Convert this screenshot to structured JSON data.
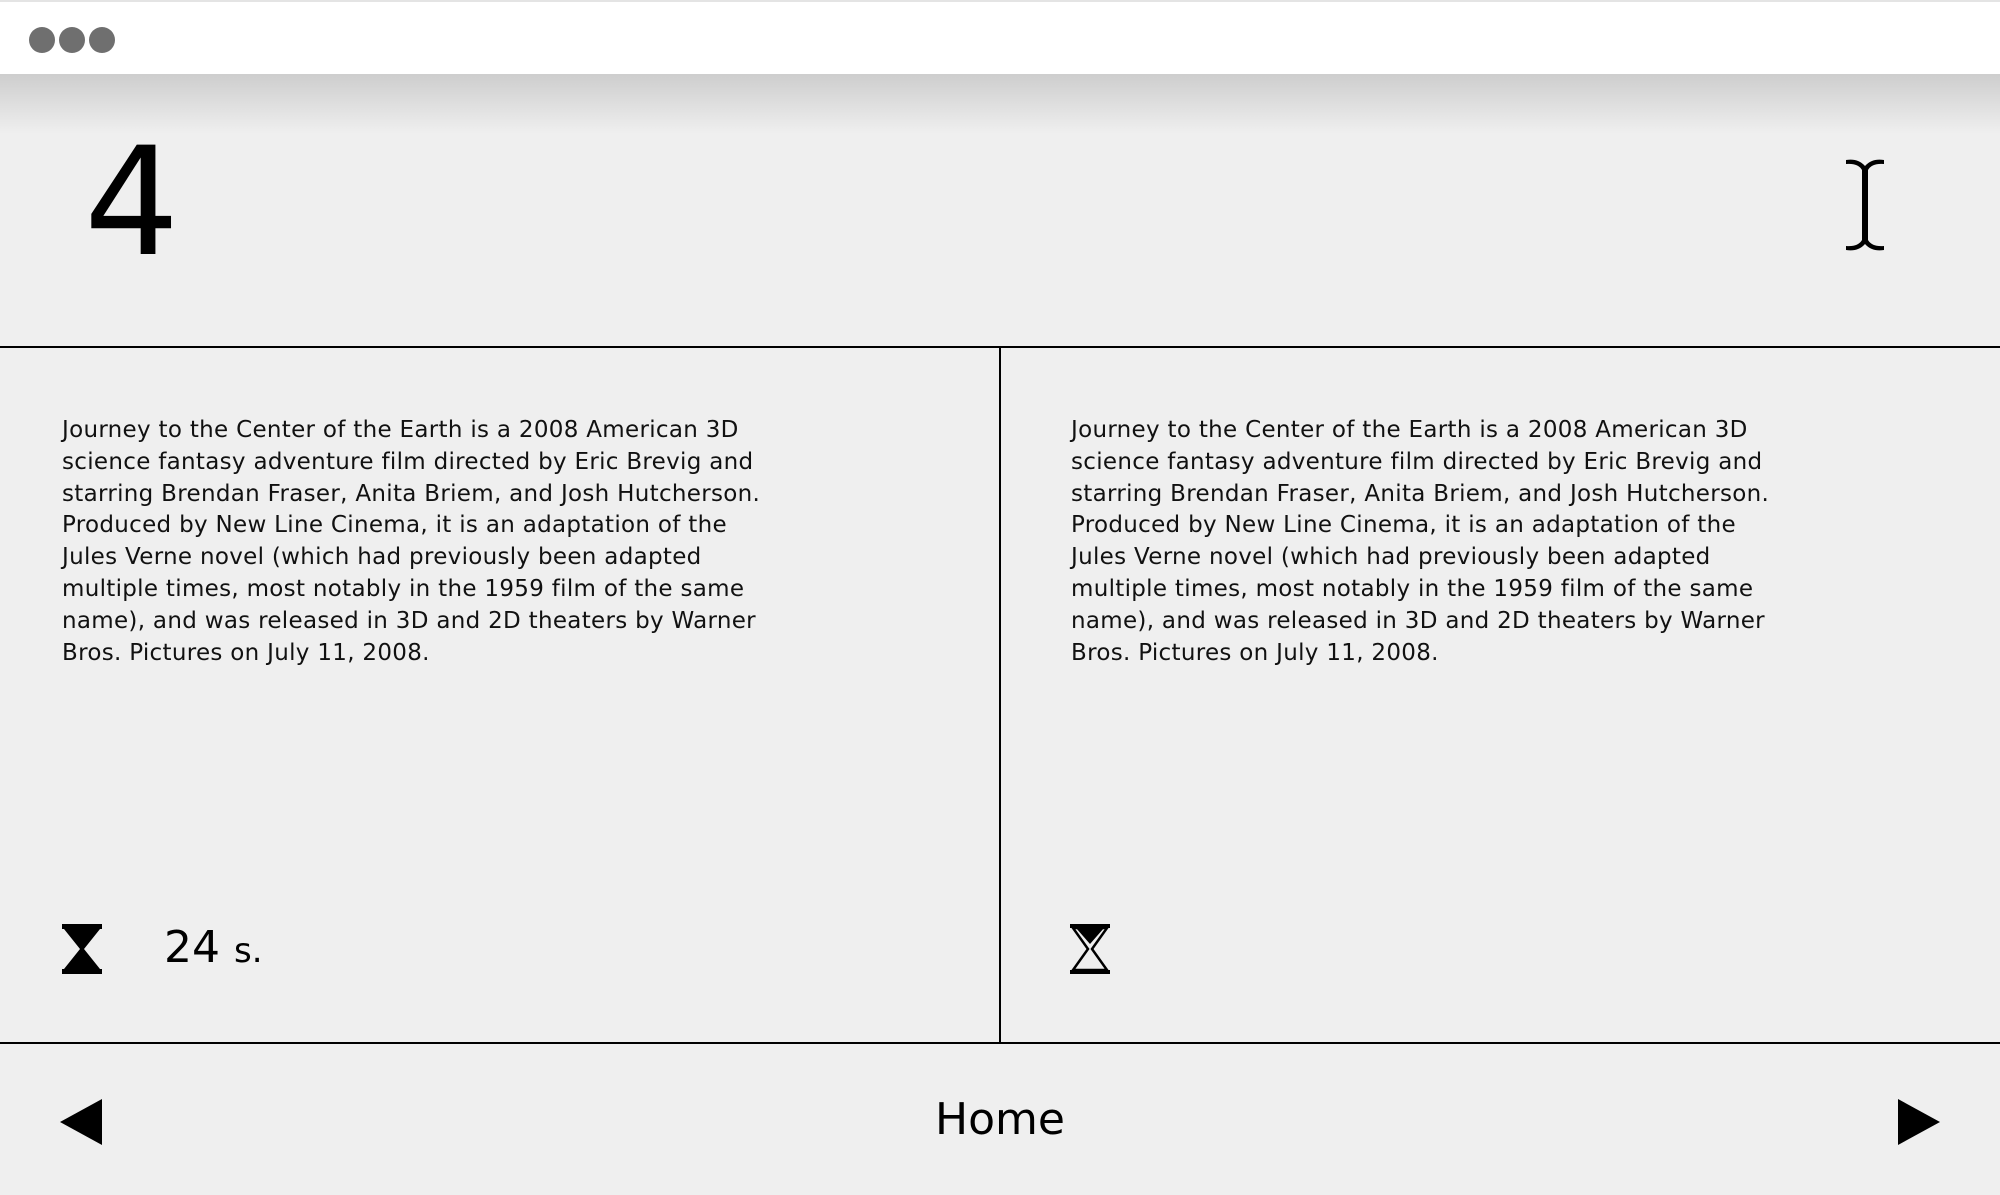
{
  "window": {
    "controls": [
      "window-dot",
      "window-dot",
      "window-dot"
    ]
  },
  "header": {
    "counter": "4",
    "cursor_icon": "text-cursor-icon"
  },
  "panels": [
    {
      "text": "Journey to the Center of the Earth is a 2008 American 3D science fantasy adventure film directed by Eric Brevig and starring Brendan Fraser, Anita Briem, and Josh Hutcherson. Produced by New Line Cinema, it is an adaptation of the Jules Verne novel (which had previously been adapted multiple times, most notably in the 1959 film of the same name), and was released in 3D and 2D theaters by Warner Bros. Pictures on July 11, 2008.",
      "timer_icon": "hourglass-filled-icon",
      "timer_value": "24",
      "timer_unit": "s."
    },
    {
      "text": "Journey to the Center of the Earth is a 2008 American 3D science fantasy adventure film directed by Eric Brevig and starring Brendan Fraser, Anita Briem, and Josh Hutcherson. Produced by New Line Cinema, it is an adaptation of the Jules Verne novel (which had previously been adapted multiple times, most notably in the 1959 film of the same name), and was released in 3D and 2D theaters by Warner Bros. Pictures on July 11, 2008.",
      "timer_icon": "hourglass-empty-icon"
    }
  ],
  "footer": {
    "prev_icon": "triangle-left-icon",
    "home_label": "Home",
    "next_icon": "triangle-right-icon"
  },
  "colors": {
    "background": "#efefef",
    "titlebar": "#ffffff",
    "dots": "#6f6f6f",
    "ink": "#000000"
  }
}
